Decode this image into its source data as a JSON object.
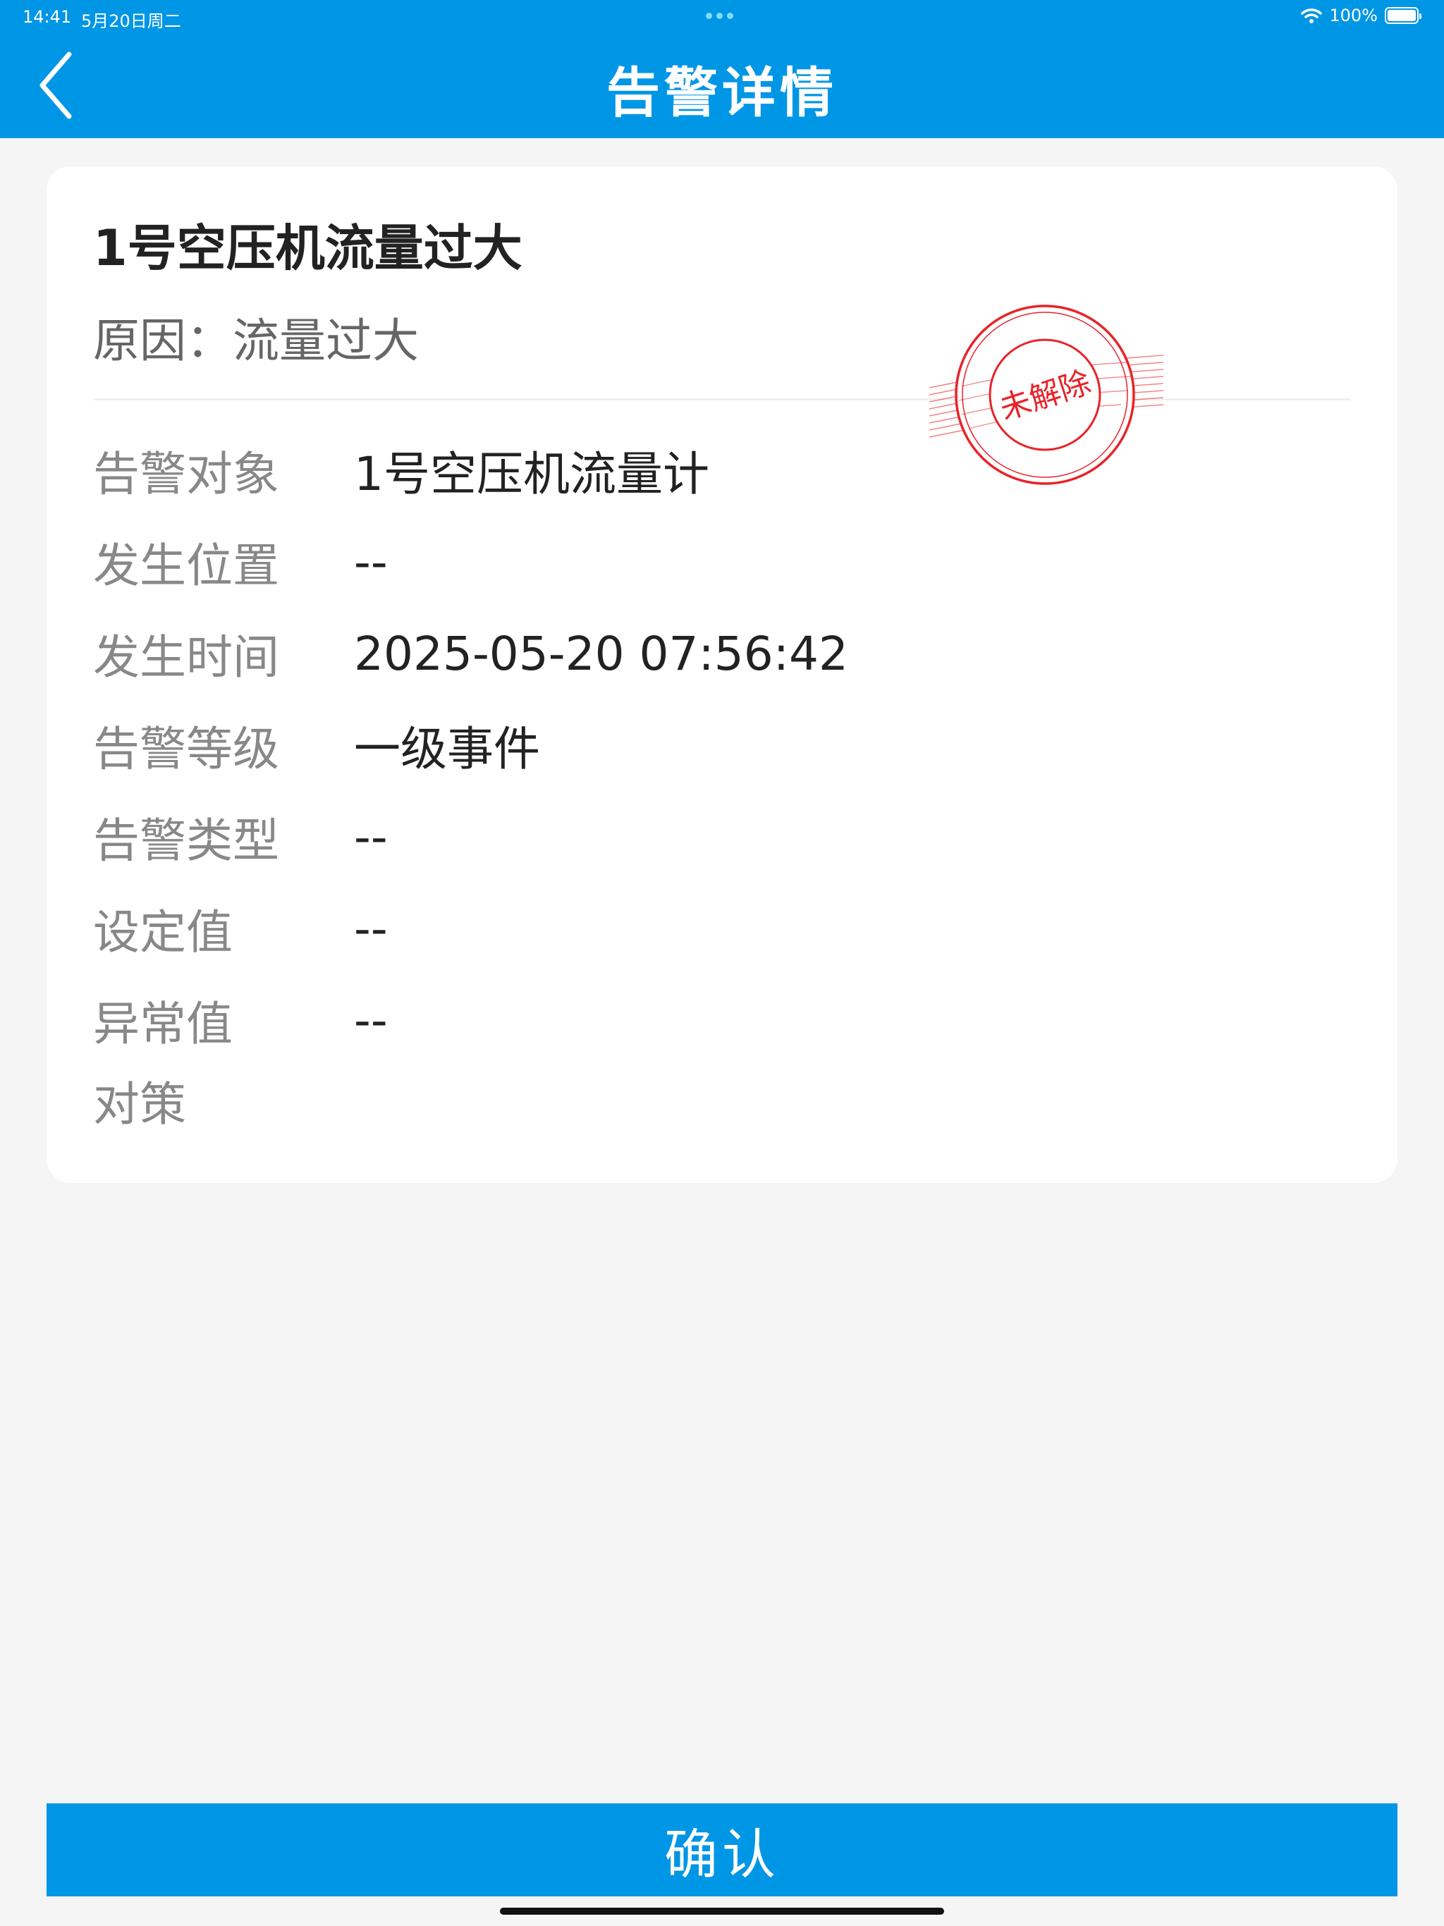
{
  "status_bar": {
    "time": "14:41",
    "date": "5月20日周二",
    "battery": "100%"
  },
  "header": {
    "title": "告警详情"
  },
  "alarm": {
    "title": "1号空压机流量过大",
    "reason": "原因：流量过大",
    "stamp_text": "未解除",
    "fields": [
      {
        "label": "告警对象",
        "value": "1号空压机流量计"
      },
      {
        "label": "发生位置",
        "value": "--"
      },
      {
        "label": "发生时间",
        "value": "2025-05-20 07:56:42"
      },
      {
        "label": "告警等级",
        "value": "一级事件"
      },
      {
        "label": "告警类型",
        "value": "--"
      },
      {
        "label": "设定值",
        "value": "--"
      },
      {
        "label": "异常值",
        "value": "--"
      },
      {
        "label": "对策",
        "value": ""
      }
    ]
  },
  "footer": {
    "confirm_label": "确认"
  },
  "colors": {
    "primary": "#0096e6",
    "stamp": "#e8232a",
    "background": "#f5f5f5"
  }
}
